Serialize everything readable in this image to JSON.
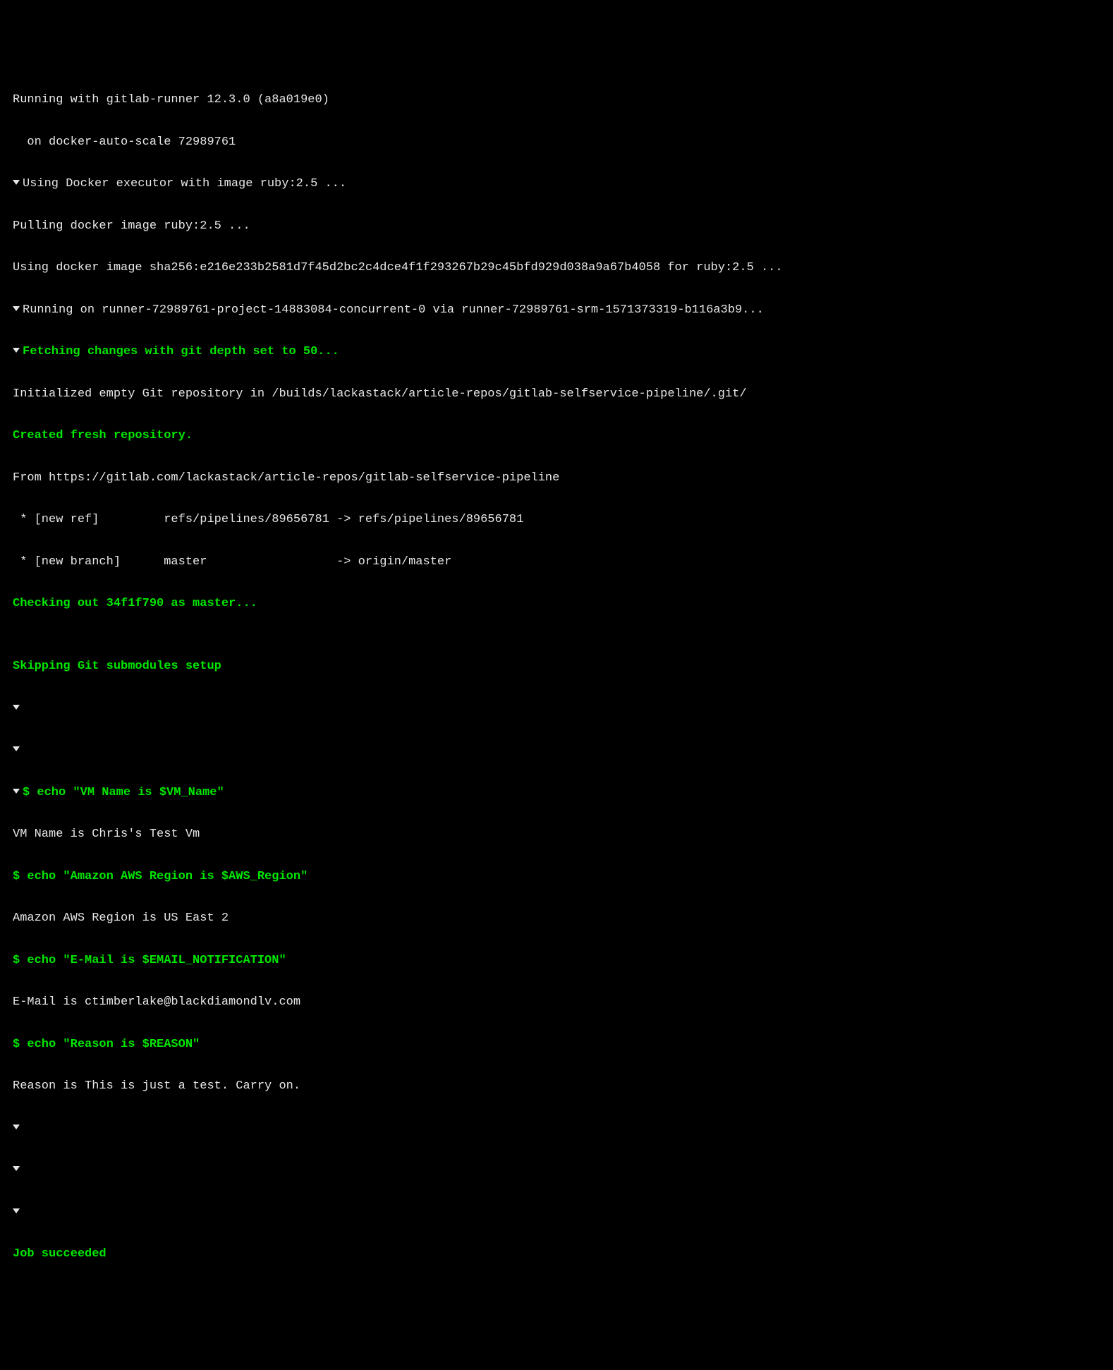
{
  "lines": {
    "l0": "Running with gitlab-runner 12.3.0 (a8a019e0)",
    "l1": "  on docker-auto-scale 72989761",
    "l2": "Using Docker executor with image ruby:2.5 ...",
    "l3": "Pulling docker image ruby:2.5 ...",
    "l4": "Using docker image sha256:e216e233b2581d7f45d2bc2c4dce4f1f293267b29c45bfd929d038a9a67b4058 for ruby:2.5 ...",
    "l5": "Running on runner-72989761-project-14883084-concurrent-0 via runner-72989761-srm-1571373319-b116a3b9...",
    "l6": "Fetching changes with git depth set to 50...",
    "l7": "Initialized empty Git repository in /builds/lackastack/article-repos/gitlab-selfservice-pipeline/.git/",
    "l8": "Created fresh repository.",
    "l9": "From https://gitlab.com/lackastack/article-repos/gitlab-selfservice-pipeline",
    "l10": " * [new ref]         refs/pipelines/89656781 -> refs/pipelines/89656781",
    "l11": " * [new branch]      master                  -> origin/master",
    "l12": "Checking out 34f1f790 as master...",
    "l13": "",
    "l14": "Skipping Git submodules setup",
    "l15": "$ echo \"VM Name is $VM_Name\"",
    "l16": "VM Name is Chris's Test Vm",
    "l17": "$ echo \"Amazon AWS Region is $AWS_Region\"",
    "l18": "Amazon AWS Region is US East 2",
    "l19": "$ echo \"E-Mail is $EMAIL_NOTIFICATION\"",
    "l20": "E-Mail is ctimberlake@blackdiamondlv.com",
    "l21": "$ echo \"Reason is $REASON\"",
    "l22": "Reason is This is just a test. Carry on.",
    "l23": "Job succeeded"
  }
}
